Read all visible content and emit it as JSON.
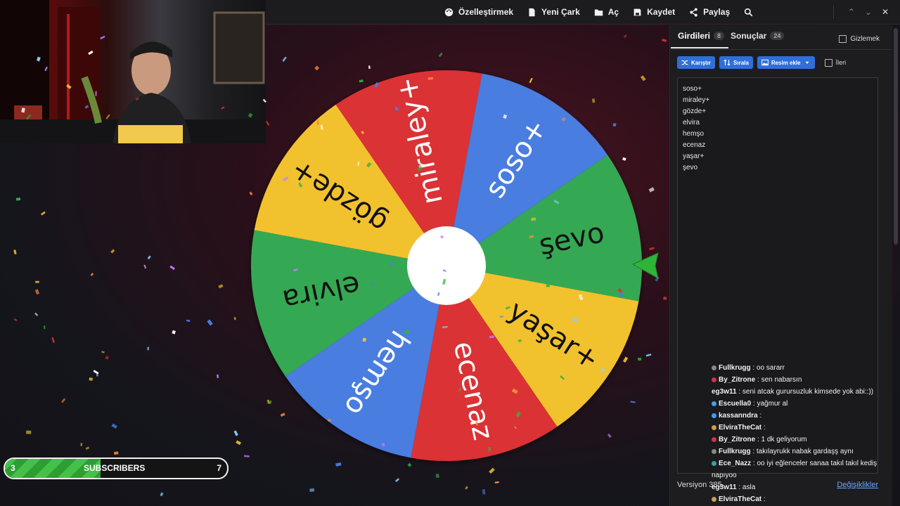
{
  "menu": {
    "customize": "Özelleştirmek",
    "new_wheel": "Yeni Çark",
    "open": "Aç",
    "save": "Kaydet",
    "share": "Paylaş"
  },
  "wheel": {
    "segments": [
      {
        "label": "şevo",
        "color": "#34a853"
      },
      {
        "label": "yaşar+",
        "color": "#f2c12e"
      },
      {
        "label": "ecenaz",
        "color": "#db3236"
      },
      {
        "label": "hemşo",
        "color": "#4a7de0"
      },
      {
        "label": "elvira",
        "color": "#34a853"
      },
      {
        "label": "gözde+",
        "color": "#f2c12e"
      },
      {
        "label": "miraley+",
        "color": "#db3236"
      },
      {
        "label": "soso+",
        "color": "#4a7de0"
      }
    ],
    "pointer_color": "#2fb43a"
  },
  "panel": {
    "tab_entries": "Girdileri",
    "tab_entries_count": "8",
    "tab_results": "Sonuçlar",
    "tab_results_count": "24",
    "hide_label": "Gizlemek",
    "shuffle_label": "Karıştır",
    "sort_label": "Sırala",
    "add_image_label": "Resim ekle",
    "advanced_label": "İleri",
    "entries": [
      "soso+",
      "miraley+",
      "gözde+",
      "elvira",
      "hemşo",
      "ecenaz",
      "yaşar+",
      "şevo"
    ],
    "version": "Versiyon 385",
    "changes": "Değişiklikler"
  },
  "chat": [
    {
      "user": "Fullkrugg",
      "color": "#7CFC7C",
      "text": ": oo sararr"
    },
    {
      "user": "By_Zitrone",
      "color": "#e0407a",
      "text": ": sen nabarsın"
    },
    {
      "user": "eg3w11",
      "color": "#b88cff",
      "text": ": seni atcak gurursuzluk kimsede yok abi::))"
    },
    {
      "user": "Escuella0",
      "color": "#7CFC7C",
      "text": ": yağmur al"
    },
    {
      "user": "kassanndra",
      "color": "#e0407a",
      "text": ":"
    },
    {
      "user": "ElviraTheCat",
      "color": "#e06aa6",
      "text": ":"
    },
    {
      "user": "By_Zitrone",
      "color": "#e0407a",
      "text": ": 1 dk geliyorum"
    },
    {
      "user": "Fullkrugg",
      "color": "#7CFC7C",
      "text": ": takılayrukk nabak gardaşş aynı"
    },
    {
      "user": "Ece_Nazz",
      "color": "#e0407a",
      "text": ": oo iyi eğlenceler sanaa takıl takıl kediş napıyoo"
    },
    {
      "user": "eg3w11",
      "color": "#b88cff",
      "text": ": asla"
    },
    {
      "user": "ElviraTheCat",
      "color": "#e06aa6",
      "text": ":"
    }
  ],
  "subscribers": {
    "current": "3",
    "label": "SUBSCRIBERS",
    "goal": "7",
    "progress": 0.43
  }
}
